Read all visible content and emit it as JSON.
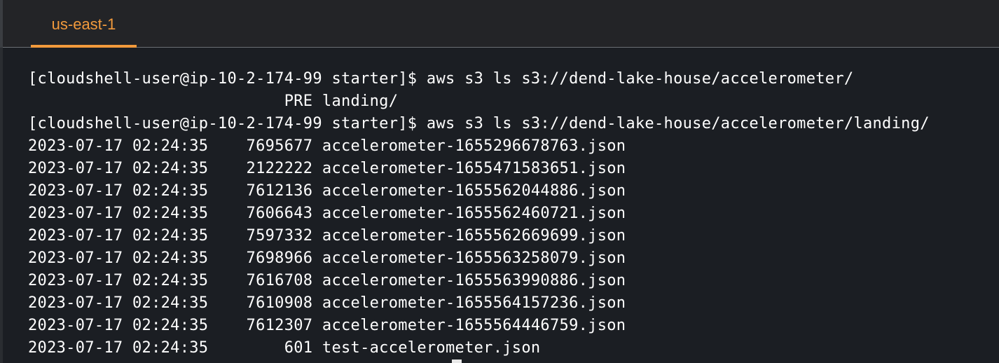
{
  "tabs": [
    {
      "label": "us-east-1",
      "active": true
    }
  ],
  "terminal": {
    "lines": [
      "[cloudshell-user@ip-10-2-174-99 starter]$ aws s3 ls s3://dend-lake-house/accelerometer/",
      "                           PRE landing/",
      "[cloudshell-user@ip-10-2-174-99 starter]$ aws s3 ls s3://dend-lake-house/accelerometer/landing/",
      "2023-07-17 02:24:35    7695677 accelerometer-1655296678763.json",
      "2023-07-17 02:24:35    2122222 accelerometer-1655471583651.json",
      "2023-07-17 02:24:35    7612136 accelerometer-1655562044886.json",
      "2023-07-17 02:24:35    7606643 accelerometer-1655562460721.json",
      "2023-07-17 02:24:35    7597332 accelerometer-1655562669699.json",
      "2023-07-17 02:24:35    7698966 accelerometer-1655563258079.json",
      "2023-07-17 02:24:35    7616708 accelerometer-1655563990886.json",
      "2023-07-17 02:24:35    7610908 accelerometer-1655564157236.json",
      "2023-07-17 02:24:35    7612307 accelerometer-1655564446759.json",
      "2023-07-17 02:24:35        601 test-accelerometer.json"
    ]
  },
  "colors": {
    "accent": "#f29a3c",
    "terminal_bg": "#1b1e23",
    "text": "#ffffff"
  }
}
